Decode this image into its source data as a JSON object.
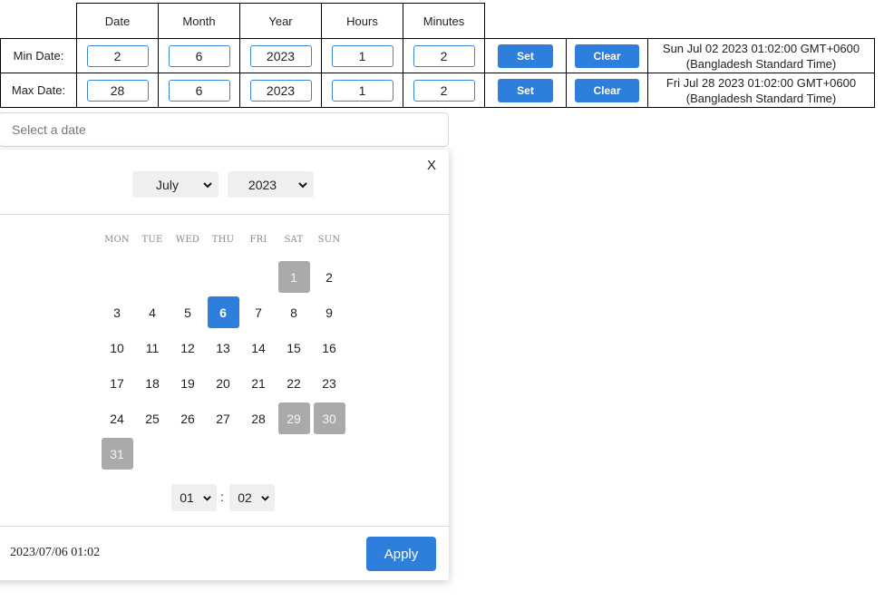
{
  "table": {
    "headers": [
      "Date",
      "Month",
      "Year",
      "Hours",
      "Minutes"
    ],
    "rows": [
      {
        "label": "Min Date:",
        "date": "2",
        "month": "6",
        "year": "2023",
        "hours": "1",
        "minutes": "2",
        "set_label": "Set",
        "clear_label": "Clear",
        "display_line1": "Sun Jul 02 2023 01:02:00 GMT+0600",
        "display_line2": "(Bangladesh Standard Time)"
      },
      {
        "label": "Max Date:",
        "date": "28",
        "month": "6",
        "year": "2023",
        "hours": "1",
        "minutes": "2",
        "set_label": "Set",
        "clear_label": "Clear",
        "display_line1": "Fri Jul 28 2023 01:02:00 GMT+0600",
        "display_line2": "(Bangladesh Standard Time)"
      }
    ]
  },
  "date_input": {
    "placeholder": "Select a date",
    "value": ""
  },
  "picker": {
    "close_label": "X",
    "month": "July",
    "year": "2023",
    "weekdays": [
      "MON",
      "TUE",
      "WED",
      "THU",
      "FRI",
      "SAT",
      "SUN"
    ],
    "days": [
      {
        "label": "1",
        "state": "disabled"
      },
      {
        "label": "2",
        "state": "normal"
      },
      {
        "label": "3",
        "state": "normal"
      },
      {
        "label": "4",
        "state": "normal"
      },
      {
        "label": "5",
        "state": "normal"
      },
      {
        "label": "6",
        "state": "selected"
      },
      {
        "label": "7",
        "state": "normal"
      },
      {
        "label": "8",
        "state": "normal"
      },
      {
        "label": "9",
        "state": "normal"
      },
      {
        "label": "10",
        "state": "normal"
      },
      {
        "label": "11",
        "state": "normal"
      },
      {
        "label": "12",
        "state": "normal"
      },
      {
        "label": "13",
        "state": "normal"
      },
      {
        "label": "14",
        "state": "normal"
      },
      {
        "label": "15",
        "state": "normal"
      },
      {
        "label": "16",
        "state": "normal"
      },
      {
        "label": "17",
        "state": "normal"
      },
      {
        "label": "18",
        "state": "normal"
      },
      {
        "label": "19",
        "state": "normal"
      },
      {
        "label": "20",
        "state": "normal"
      },
      {
        "label": "21",
        "state": "normal"
      },
      {
        "label": "22",
        "state": "normal"
      },
      {
        "label": "23",
        "state": "normal"
      },
      {
        "label": "24",
        "state": "normal"
      },
      {
        "label": "25",
        "state": "normal"
      },
      {
        "label": "26",
        "state": "normal"
      },
      {
        "label": "27",
        "state": "normal"
      },
      {
        "label": "28",
        "state": "normal"
      },
      {
        "label": "29",
        "state": "disabled"
      },
      {
        "label": "30",
        "state": "disabled"
      },
      {
        "label": "31",
        "state": "disabled"
      }
    ],
    "hour": "01",
    "minute": "02",
    "time_separator": ":",
    "result_text": "2023/07/06 01:02",
    "apply_label": "Apply"
  },
  "colors": {
    "accent": "#2e7fdc",
    "disabled_day": "#aaaaaa",
    "select_bg": "#efefef"
  },
  "icons": {
    "dropdown": "chevron-down-icon"
  }
}
